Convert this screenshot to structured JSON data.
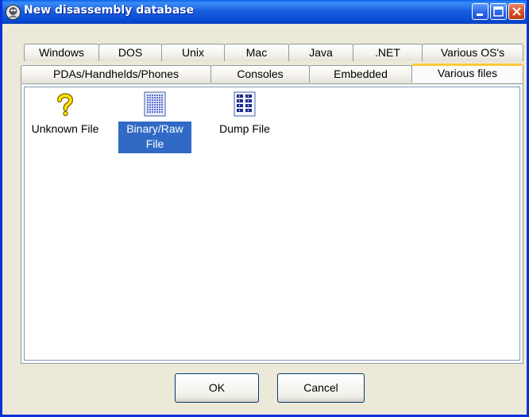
{
  "window": {
    "title": "New disassembly database"
  },
  "tabs": {
    "row1": [
      "Windows",
      "DOS",
      "Unix",
      "Mac",
      "Java",
      ".NET",
      "Various OS's"
    ],
    "row2": [
      "PDAs/Handhelds/Phones",
      "Consoles",
      "Embedded",
      "Various files"
    ],
    "selected": "Various files"
  },
  "items": [
    {
      "label": "Unknown File",
      "icon": "question-mark-icon",
      "selected": false
    },
    {
      "label": "Binary/Raw File",
      "line1": "Binary/Raw",
      "line2": "File",
      "icon": "binary-file-icon",
      "selected": true
    },
    {
      "label": "Dump File",
      "icon": "dump-file-icon",
      "selected": false
    }
  ],
  "buttons": {
    "ok": "OK",
    "cancel": "Cancel"
  },
  "colors": {
    "titlebar": "#0A4FD5",
    "selection": "#316AC5",
    "tab_highlight": "#FFC83C",
    "close": "#D3491E"
  }
}
